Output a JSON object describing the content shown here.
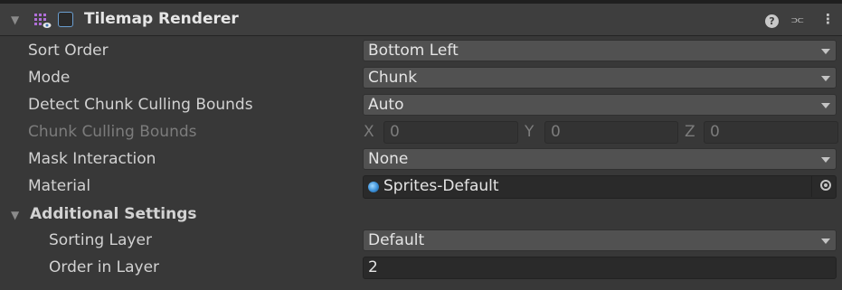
{
  "header": {
    "title": "Tilemap Renderer",
    "help_icon_glyph": "?",
    "presets_icon_glyph": "⫗",
    "more_icon_glyph": "⋮"
  },
  "fields": {
    "sort_order": {
      "label": "Sort Order",
      "value": "Bottom Left"
    },
    "mode": {
      "label": "Mode",
      "value": "Chunk"
    },
    "detect_bounds": {
      "label": "Detect Chunk Culling Bounds",
      "value": "Auto"
    },
    "culling_bounds": {
      "label": "Chunk Culling Bounds",
      "x_label": "X",
      "x_value": "0",
      "y_label": "Y",
      "y_value": "0",
      "z_label": "Z",
      "z_value": "0"
    },
    "mask_interaction": {
      "label": "Mask Interaction",
      "value": "None"
    },
    "material": {
      "label": "Material",
      "value": "Sprites-Default"
    }
  },
  "additional": {
    "title": "Additional Settings",
    "sorting_layer": {
      "label": "Sorting Layer",
      "value": "Default"
    },
    "order_in_layer": {
      "label": "Order in Layer",
      "value": "2"
    }
  },
  "colors": {
    "panel_bg": "#383838",
    "header_bg": "#3e3e3e",
    "dropdown_bg": "#515151",
    "field_bg": "#2a2a2a",
    "accent": "#6a9ed0"
  }
}
